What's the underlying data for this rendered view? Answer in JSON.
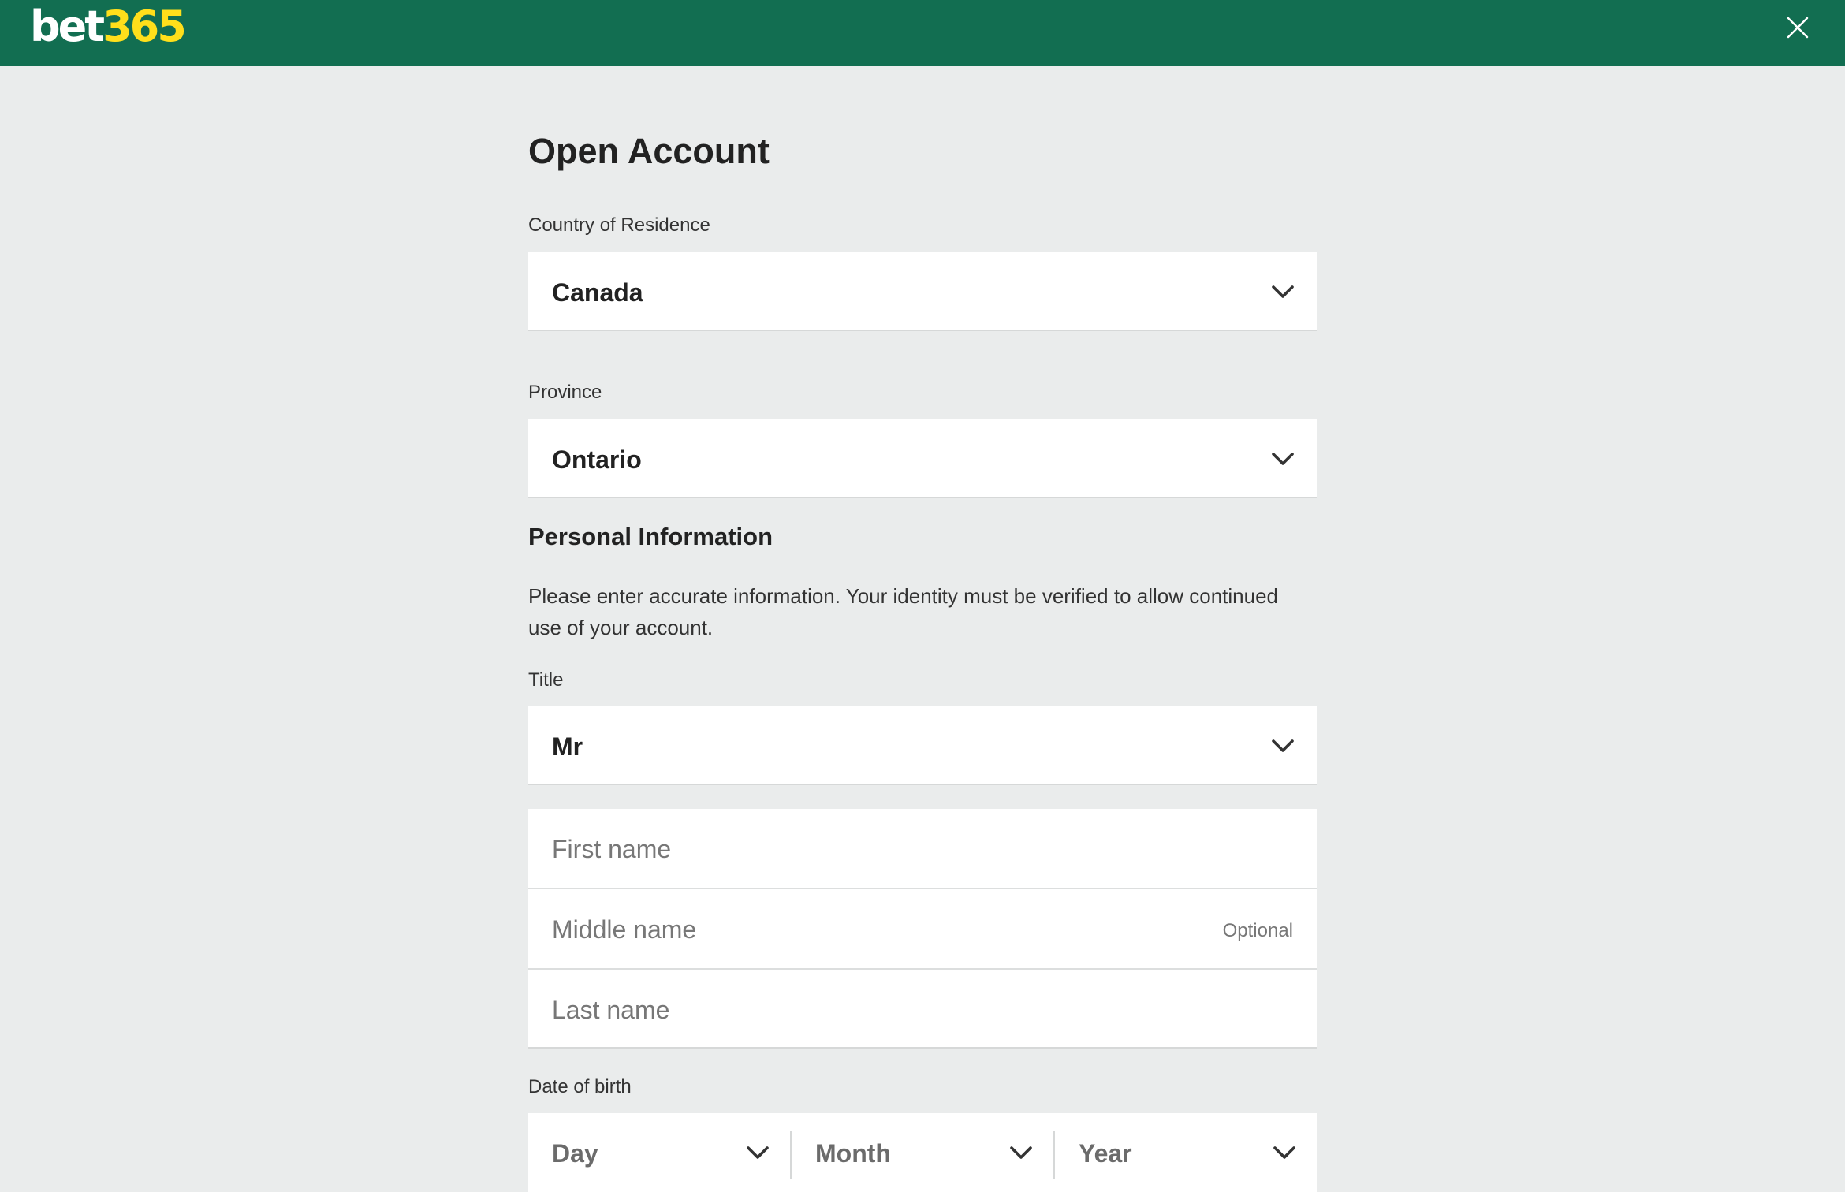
{
  "header": {
    "logo_part1": "bet",
    "logo_part2": "365",
    "close_icon": "close-icon",
    "background_color": "#126e51",
    "logo_accent_color": "#ffdf1b"
  },
  "form": {
    "title": "Open Account",
    "country": {
      "label": "Country of Residence",
      "value": "Canada",
      "icon": "chevron-down-icon"
    },
    "province": {
      "label": "Province",
      "value": "Ontario",
      "icon": "chevron-down-icon"
    },
    "personal": {
      "heading": "Personal Information",
      "description": "Please enter accurate information. Your identity must be verified to allow continued use of your account."
    },
    "title_field": {
      "label": "Title",
      "value": "Mr",
      "icon": "chevron-down-icon"
    },
    "first_name": {
      "placeholder": "First name",
      "value": ""
    },
    "middle_name": {
      "placeholder": "Middle name",
      "value": "",
      "optional_label": "Optional"
    },
    "last_name": {
      "placeholder": "Last name",
      "value": ""
    },
    "dob": {
      "label": "Date of birth",
      "day": "Day",
      "month": "Month",
      "year": "Year"
    }
  }
}
